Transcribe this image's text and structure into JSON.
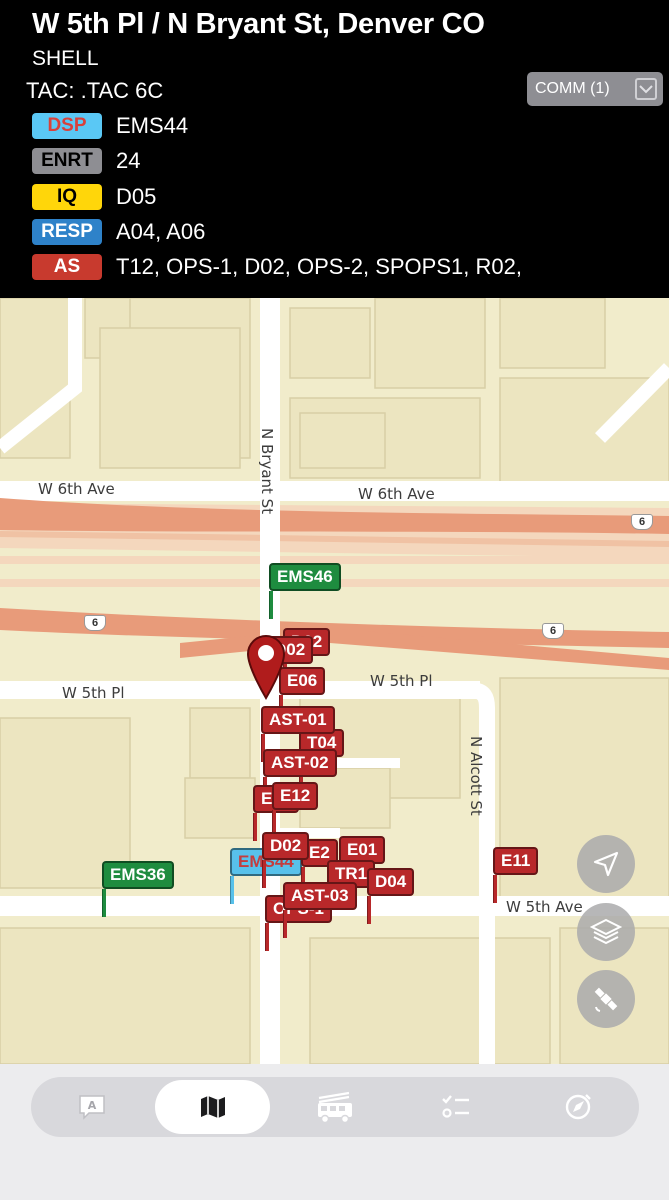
{
  "header": {
    "address": "W 5th Pl / N Bryant St, Denver CO",
    "incident_type": "SHELL",
    "tac": "TAC: .TAC 6C",
    "comm_button": "COMM (1)"
  },
  "statuses": [
    {
      "code": "DSP",
      "units": "EMS44",
      "bg": "#5ac8f5",
      "fg": "#d9403a"
    },
    {
      "code": "ENRT",
      "units": "24",
      "bg": "#8e8e93",
      "fg": "#000000"
    },
    {
      "code": "IQ",
      "units": "D05",
      "bg": "#ffd60a",
      "fg": "#000000"
    },
    {
      "code": "RESP",
      "units": "A04, A06",
      "bg": "#2e82c9",
      "fg": "#ffffff"
    },
    {
      "code": "AS",
      "units": "T12, OPS-1, D02, OPS-2, SPOPS1, R02,",
      "bg": "#c83a2e",
      "fg": "#ffffff"
    }
  ],
  "map": {
    "streets": {
      "w6th_left": "W 6th Ave",
      "w6th_right": "W 6th Ave",
      "bryant": "N Bryant St",
      "w5thpl_left": "W 5th Pl",
      "w5thpl_right": "W 5th Pl",
      "alcott": "N Alcott St",
      "w5thave": "W 5th Ave"
    },
    "highway_shields": [
      "6",
      "6",
      "6"
    ],
    "units": {
      "ems46": "EMS46",
      "ems36": "EMS36",
      "ems44": "EMS44",
      "d02_top": "D02",
      "e06": "E06",
      "ast01": "AST-01",
      "t04": "T04",
      "ast02": "AST-02",
      "e12": "E12",
      "d02": "D02",
      "e2x": "E2",
      "e01": "E01",
      "tr1": "TR1",
      "d04": "D04",
      "ast03": "AST-03",
      "ops": "OPS-1",
      "e11": "E11"
    },
    "colors": {
      "unit_red": "#b8282a",
      "unit_green": "#1e8c3f",
      "unit_blue": "#58c1ea",
      "highway": "#e89b7a"
    }
  },
  "controls": [
    "locate-icon",
    "layers-icon",
    "satellite-icon"
  ],
  "tabs": [
    {
      "name": "messages-icon",
      "active": false
    },
    {
      "name": "map-icon",
      "active": true
    },
    {
      "name": "apparatus-icon",
      "active": false
    },
    {
      "name": "checklist-icon",
      "active": false
    },
    {
      "name": "compass-icon",
      "active": false
    }
  ]
}
